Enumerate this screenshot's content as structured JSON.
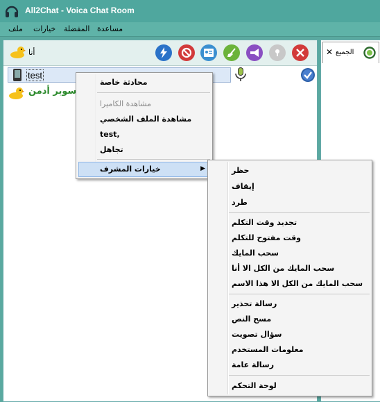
{
  "window": {
    "title": "All2Chat - Voica Chat Room"
  },
  "menubar": {
    "file": "ملف",
    "options": "خيارات",
    "favorites": "المفضلة",
    "help": "مساعدة"
  },
  "toolbar": {
    "me_label": "أنا"
  },
  "users": [
    {
      "name": "test"
    },
    {
      "name": "سوبر أدمن"
    }
  ],
  "tabs": [
    {
      "label": "الجميع"
    }
  ],
  "context_menu": {
    "items": [
      {
        "label": "محادثة خاصة",
        "enabled": true
      },
      {
        "label": "مشاهدة الكاميرا",
        "enabled": false
      },
      {
        "label": "مشاهدة الملف الشخصي",
        "enabled": true
      },
      {
        "label": "test,",
        "enabled": true
      },
      {
        "label": "تجاهل",
        "enabled": true
      },
      {
        "label": "خيارات المشرف",
        "enabled": true
      }
    ]
  },
  "admin_submenu": {
    "items": [
      "حظر",
      "إيقاف",
      "طرد",
      "تجديد وقت التكلم",
      "وقت مفتوح للتكلم",
      "سحب المايك",
      "سحب المايك من الكل الا أنا",
      "سحب المايك من الكل الا هذا الاسم",
      "رسالة تحذير",
      "مسح النص",
      "سؤال تصويت",
      "معلومات المستخدم",
      "رسالة عامة",
      "لوحة التحكم"
    ]
  },
  "colors": {
    "titlebar": "#4fa79e",
    "menubar": "#5fb3a8",
    "admin_name": "#2e8b2e",
    "selection": "#cde0f5"
  }
}
